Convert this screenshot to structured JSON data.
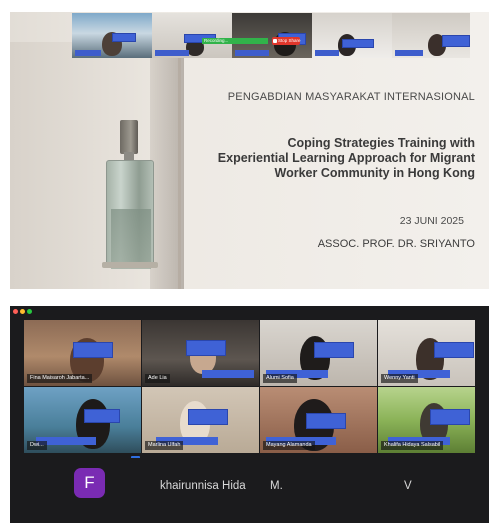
{
  "share": {
    "recording_label": "Recording...",
    "stop_label": "Stop Share",
    "slide": {
      "heading": "PENGABDIAN MASYARAKAT INTERNASIONAL",
      "title_lines": [
        "Coping Strategies Training with",
        "Experiential Learning Approach for Migrant",
        "Worker Community in Hong Kong"
      ],
      "date": "23 JUNI 2025",
      "presenter": "ASSOC. PROF. DR. SRIYANTO"
    }
  },
  "gallery": {
    "window_dots": [
      "#ff5f57",
      "#febc2e",
      "#28c840"
    ],
    "tiles": [
      {
        "name": "Fina Maisaroh Jabarta..."
      },
      {
        "name": "Ade Lia"
      },
      {
        "name": "Alumi Sofia"
      },
      {
        "name": "Wenny Yanti"
      },
      {
        "name": "Dwi..."
      },
      {
        "name": "Marlina Ulfah"
      },
      {
        "name": "Mayang Alamanda"
      },
      {
        "name": "Khalifa Hidaya Salsabil"
      }
    ],
    "avatars": [
      {
        "initial": "F",
        "name": "khairunnisa Hida"
      },
      {
        "initial": "",
        "name": "M."
      },
      {
        "initial": "",
        "name": "V"
      }
    ]
  },
  "colors": {
    "redaction": "#3f62d6",
    "active_speaker": "#2ec45a",
    "gallery_bg": "#1b1b1d",
    "avatar_purple": "#7a2bb3"
  }
}
